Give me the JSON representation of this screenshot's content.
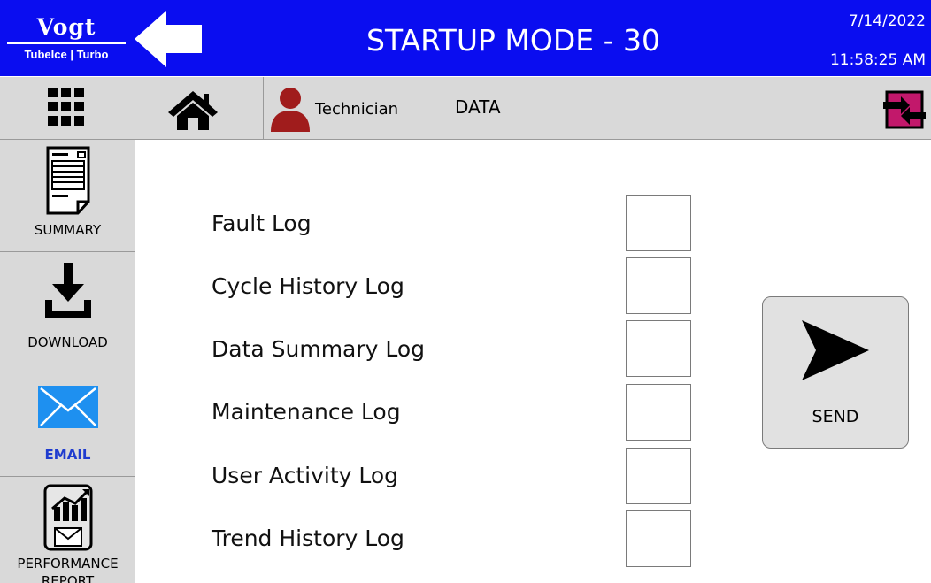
{
  "header": {
    "logo": {
      "name": "Vogt",
      "brands": "TubeIce | Turbo"
    },
    "title": "STARTUP MODE - 30",
    "date": "7/14/2022",
    "time": "11:58:25 AM"
  },
  "navbar": {
    "user_label": "Technician",
    "section_label": "DATA"
  },
  "sidebar": {
    "items": [
      {
        "label": "SUMMARY",
        "icon": "summary-document-icon"
      },
      {
        "label": "DOWNLOAD",
        "icon": "download-icon"
      },
      {
        "label": "EMAIL",
        "icon": "email-icon",
        "active": true
      },
      {
        "label": "PERFORMANCE REPORT",
        "icon": "performance-report-icon"
      }
    ]
  },
  "main": {
    "logs": [
      {
        "label": "Fault Log",
        "checked": false
      },
      {
        "label": "Cycle History Log",
        "checked": false
      },
      {
        "label": "Data Summary Log",
        "checked": false
      },
      {
        "label": "Maintenance Log",
        "checked": false
      },
      {
        "label": "User Activity Log",
        "checked": false
      },
      {
        "label": "Trend History Log",
        "checked": false
      }
    ],
    "send_label": "SEND"
  },
  "colors": {
    "header_bg": "#0a0df0",
    "toolbar_bg": "#d9d9d9",
    "user_icon": "#a01c1c",
    "switch_icon": "#c2186b",
    "active_sidebar_text": "#1f3ccf"
  }
}
